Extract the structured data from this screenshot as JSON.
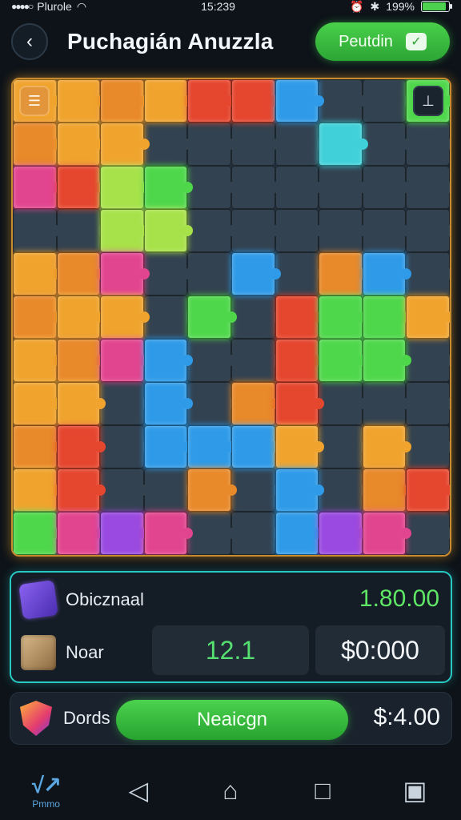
{
  "status_bar": {
    "carrier": "Plurole",
    "time": "15:239",
    "battery": "199%",
    "battery_fill": 0.92
  },
  "header": {
    "back_icon": "chevron-left-icon",
    "title": "Puchagián Anuzzla",
    "action_label": "Peutdin",
    "action_icon": "check-icon"
  },
  "board": {
    "menu_icon": "menu-icon",
    "tool_icon": "tool-icon",
    "columns": 10,
    "rows": 11,
    "colors": {
      "orange": "#f0a42e",
      "amber": "#e8892a",
      "red": "#e5462e",
      "magenta": "#e2458f",
      "green": "#4fd74c",
      "lime": "#a8e24a",
      "blue": "#2f9be8",
      "cyan": "#3fd0d9",
      "purple": "#9a4ae0",
      "slate": "#334250",
      "teal": "#2c6a7a"
    },
    "pattern": [
      [
        "orange",
        "orange",
        "amber",
        "orange",
        "red",
        "red",
        "blue",
        "slate",
        "slate",
        "green"
      ],
      [
        "amber",
        "orange",
        "orange",
        "slate",
        "slate",
        "slate",
        "slate",
        "cyan",
        "slate",
        "slate"
      ],
      [
        "magenta",
        "red",
        "lime",
        "green",
        "slate",
        "slate",
        "slate",
        "slate",
        "slate",
        "slate"
      ],
      [
        "slate",
        "slate",
        "lime",
        "lime",
        "slate",
        "slate",
        "slate",
        "slate",
        "slate",
        "slate"
      ],
      [
        "orange",
        "amber",
        "magenta",
        "slate",
        "slate",
        "blue",
        "slate",
        "amber",
        "blue",
        "slate"
      ],
      [
        "amber",
        "orange",
        "orange",
        "slate",
        "green",
        "slate",
        "red",
        "green",
        "green",
        "orange"
      ],
      [
        "orange",
        "amber",
        "magenta",
        "blue",
        "slate",
        "slate",
        "red",
        "green",
        "green",
        "slate"
      ],
      [
        "orange",
        "orange",
        "slate",
        "blue",
        "slate",
        "amber",
        "red",
        "slate",
        "slate",
        "slate"
      ],
      [
        "amber",
        "red",
        "slate",
        "blue",
        "blue",
        "blue",
        "orange",
        "slate",
        "orange",
        "slate"
      ],
      [
        "orange",
        "red",
        "slate",
        "slate",
        "amber",
        "slate",
        "blue",
        "slate",
        "amber",
        "red"
      ],
      [
        "green",
        "magenta",
        "purple",
        "magenta",
        "slate",
        "slate",
        "blue",
        "purple",
        "magenta",
        "slate"
      ]
    ]
  },
  "stats": {
    "row1_icon": "gem-icon",
    "row1_label": "Obicznaal",
    "row1_value": "1.80.00",
    "row2_icon": "box-icon",
    "row2_label": "Noar",
    "cell1_value": "12.1",
    "cell2_value": "$0:000"
  },
  "bottom": {
    "icon": "shield-icon",
    "label": "Dords",
    "button_label": "Neaicgn",
    "value": "$:4.00"
  },
  "nav": {
    "logo_glyph": "√↗",
    "logo_label": "Pmmo",
    "back_glyph": "◁",
    "home_glyph": "⌂",
    "recent_glyph": "□",
    "camera_glyph": "▣"
  }
}
